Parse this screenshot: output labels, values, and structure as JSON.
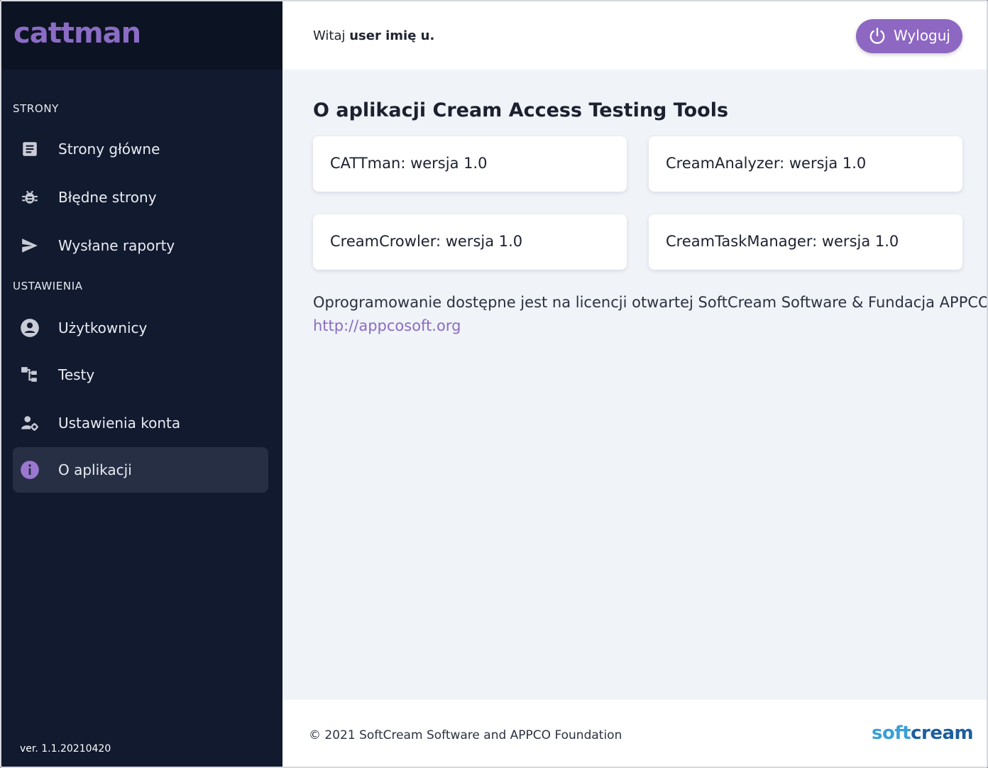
{
  "sidebar": {
    "logo": "cattman",
    "sections": [
      {
        "label": "STRONY",
        "items": [
          {
            "label": "Strony główne",
            "icon": "article-icon"
          },
          {
            "label": "Błędne strony",
            "icon": "bug-icon"
          },
          {
            "label": "Wysłane raporty",
            "icon": "send-icon"
          }
        ]
      },
      {
        "label": "USTAWIENIA",
        "items": [
          {
            "label": "Użytkownicy",
            "icon": "account-circle-icon"
          },
          {
            "label": "Testy",
            "icon": "account-tree-icon"
          },
          {
            "label": "Ustawienia konta",
            "icon": "manage-accounts-icon"
          },
          {
            "label": "O aplikacji",
            "icon": "info-icon",
            "active": true
          }
        ]
      }
    ],
    "version": "ver. 1.1.20210420"
  },
  "header": {
    "greeting_prefix": "Witaj",
    "user_name": "user imię u.",
    "logout_label": "Wyloguj"
  },
  "main": {
    "title": "O aplikacji Cream Access Testing Tools",
    "cards": [
      "CATTman: wersja 1.0",
      "CreamAnalyzer: wersja 1.0",
      "CreamCrowler: wersja 1.0",
      "CreamTaskManager: wersja 1.0"
    ],
    "license_text": "Oprogramowanie dostępne jest na licencji otwartej SoftCream Software & Fundacja APPCO",
    "link": "http://appcosoft.org"
  },
  "footer": {
    "copyright": "© 2021 SoftCream Software and APPCO Foundation",
    "brand_soft": "soft",
    "brand_cream": "cream"
  },
  "colors": {
    "sidebar_bg": "#111a2e",
    "accent": "#8d67c2",
    "main_bg": "#f0f3f8"
  }
}
